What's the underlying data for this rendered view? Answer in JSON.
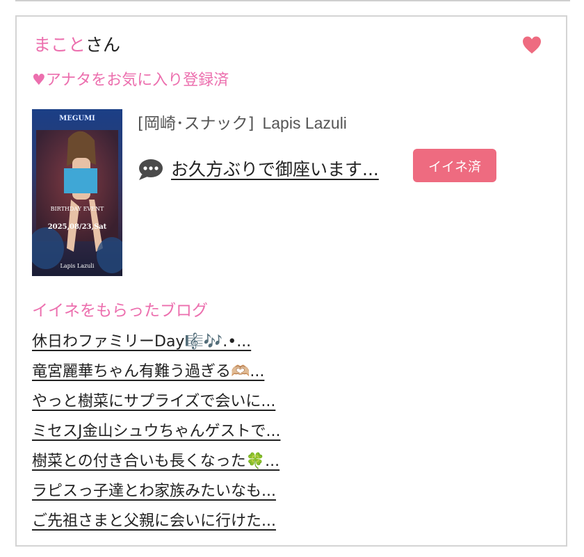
{
  "user": {
    "name": "まこと",
    "suffix": "さん"
  },
  "favorite_status": "♥アナタをお気に入り登録済",
  "thumbnail": {
    "top_text": "MEGUMI",
    "event_text": "BIRTHDAY EVENT",
    "date_text": "2025,08/23,Sat",
    "shop_text": "Lapis Lazuli"
  },
  "shop": {
    "area": "[岡崎･スナック]",
    "name": "Lapis Lazuli"
  },
  "post": {
    "title": "お久方ぶりで御座います...",
    "badge": "イイネ済"
  },
  "blogs": {
    "heading": "イイネをもらったブログ",
    "items": [
      "休日わファミリーDay🎼🎶.•...",
      "竜宮麗華ちゃん有難う過ぎる🫶🏼...",
      "やっと樹菜にサプライズで会いに...",
      "ミセスJ金山シュウちゃんゲストで...",
      "樹菜との付き合いも長くなった🍀...",
      "ラピスっ子達とわ家族みたいなも...",
      "ご先祖さまと父親に会いに行けた..."
    ]
  },
  "colors": {
    "pink_text": "#ec6fae",
    "badge": "#ee6b80",
    "heart": "#ee6b80"
  },
  "icons": {
    "favorite": "heart-icon",
    "comment": "comment-bubble-icon"
  }
}
